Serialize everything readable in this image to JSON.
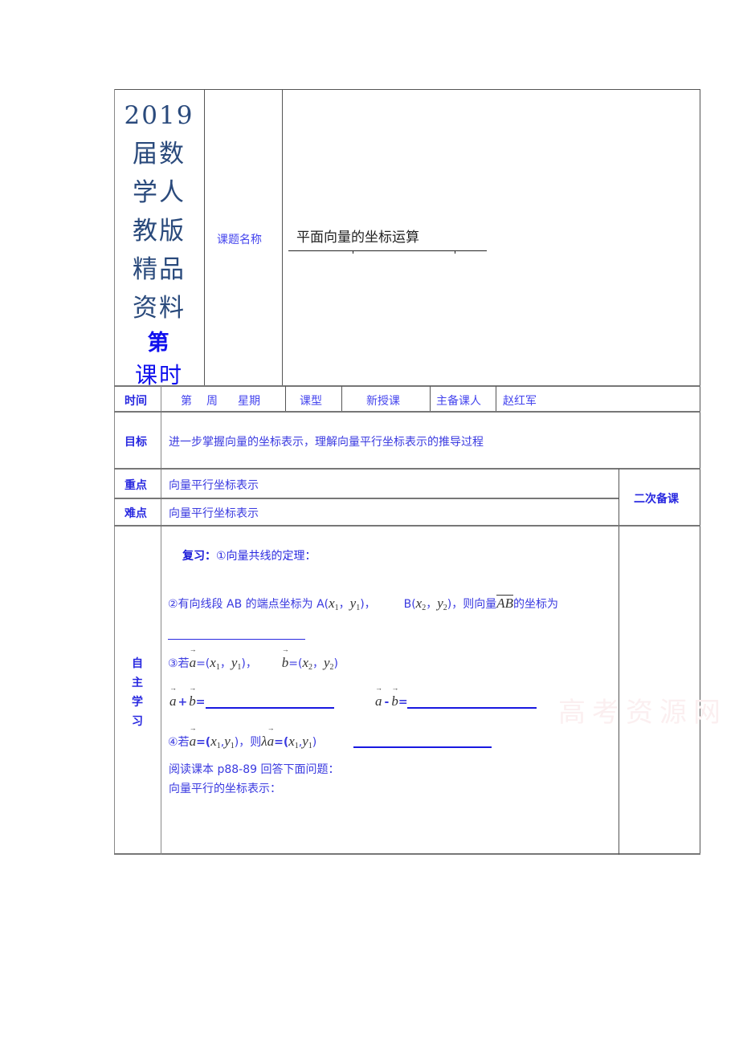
{
  "header": {
    "side_title_lines": [
      "2019",
      "届数",
      "学人",
      "教版",
      "精品",
      "资料"
    ],
    "side_title_di": "第",
    "side_title_keshi": "课时",
    "topic_label": "课题名称",
    "topic_value": "平面向量的坐标运算"
  },
  "info_row": {
    "time_label": "时间",
    "time_value": "第　周　星期",
    "week_word": "第",
    "zhou_word": "周",
    "weekday_word": "星期",
    "type_label": "课型",
    "type_value": "新授课",
    "teacher_label": "主备课人",
    "teacher_value": "赵红军"
  },
  "goal": {
    "label": "目标",
    "value": "进一步掌握向量的坐标表示，理解向量平行坐标表示的推导过程"
  },
  "key_point": {
    "label": "重点",
    "value": "向量平行坐标表示"
  },
  "difficulty": {
    "label": "难点",
    "value": "向量平行坐标表示"
  },
  "second_prep_label": "二次备课",
  "self_study": {
    "label_chars": [
      "自",
      "主",
      "学",
      "习"
    ],
    "review_label": "复习：",
    "item1": "①向量共线的定理：",
    "item2_prefix": "②有向线段 AB 的端点坐标为 A(",
    "item2_a_close": ")，",
    "item2_b_open": "B(",
    "item2_b_close": ")，则向量",
    "item2_vec": "AB",
    "item2_suffix": "的坐标为",
    "item3_prefix": "③若",
    "item4_prefix": "④若",
    "item4_then": "，则",
    "var_a": "a",
    "var_b": "b",
    "x": "x",
    "y": "y",
    "sub1": "1",
    "sub2": "2",
    "lambda": "λ",
    "eq_open": "=(",
    "comma": "，",
    "close": ")",
    "plus": "+",
    "minus": "-",
    "eq": "=",
    "reading": "阅读课本 p88-89 回答下面问题：",
    "parallel_repr": "向量平行的坐标表示："
  },
  "watermark": "高考资源网"
}
